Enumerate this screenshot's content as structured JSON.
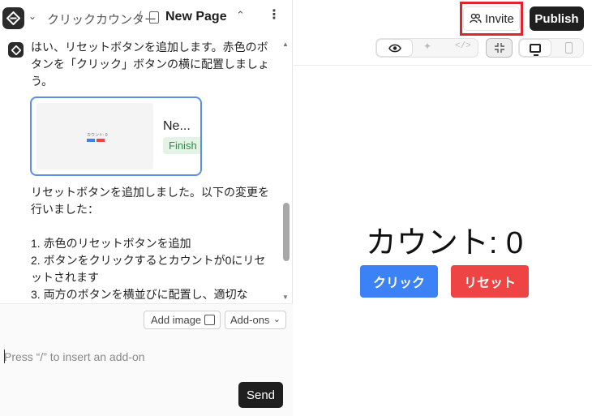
{
  "header": {
    "project_name": "クリックカウンター",
    "separator": "/",
    "page_name": "New Page"
  },
  "chat": {
    "message1": "はい、リセットボタンを追加します。赤色のボタンを「クリック」ボタンの横に配置しましょう。",
    "card": {
      "title": "Ne...",
      "status": "Finish",
      "thumbnail_text": "カウント: 0"
    },
    "message2_lines": [
      "リセットボタンを追加しました。以下の変更を行いました：",
      "",
      "1. 赤色のリセットボタンを追加",
      "2. ボタンをクリックするとカウントが0にリセットされます",
      "3. 両方のボタンを横並びに配置し、適切な"
    ]
  },
  "composer": {
    "add_image_label": "Add image",
    "addons_label": "Add-ons",
    "placeholder": "Press “/” to insert an add-on",
    "send_label": "Send"
  },
  "top_actions": {
    "invite_label": "Invite",
    "publish_label": "Publish"
  },
  "preview": {
    "count_text": "カウント: 0",
    "click_button": "クリック",
    "reset_button": "リセット",
    "click_color": "#3b82f6",
    "reset_color": "#ef4444"
  }
}
